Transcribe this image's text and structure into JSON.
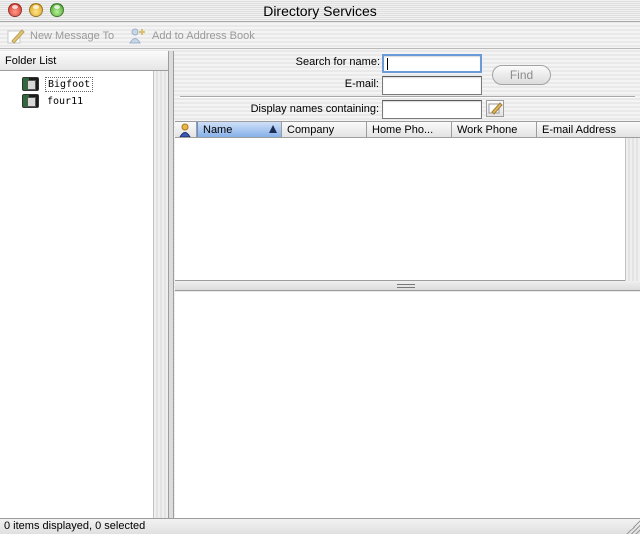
{
  "window": {
    "title": "Directory Services"
  },
  "toolbar": {
    "new_message": "New Message To",
    "add_to_address_book": "Add to Address Book"
  },
  "folder_list": {
    "header": "Folder List",
    "items": [
      {
        "label": "Bigfoot",
        "selected": true
      },
      {
        "label": "four11",
        "selected": false
      }
    ]
  },
  "search": {
    "name_label": "Search for name:",
    "name_value": "",
    "email_label": "E-mail:",
    "email_value": "",
    "find_label": "Find",
    "display_label": "Display names containing:",
    "display_value": ""
  },
  "table": {
    "columns": [
      "Name",
      "Company",
      "Home Pho...",
      "Work Phone",
      "E-mail Address"
    ],
    "sorted_column": "Name",
    "rows": []
  },
  "status": {
    "text": "0 items displayed, 0 selected"
  },
  "colors": {
    "find_text": "#8d8d8d",
    "focus_ring": "#6a9ad8",
    "sorted_header": "#86b0e8"
  }
}
